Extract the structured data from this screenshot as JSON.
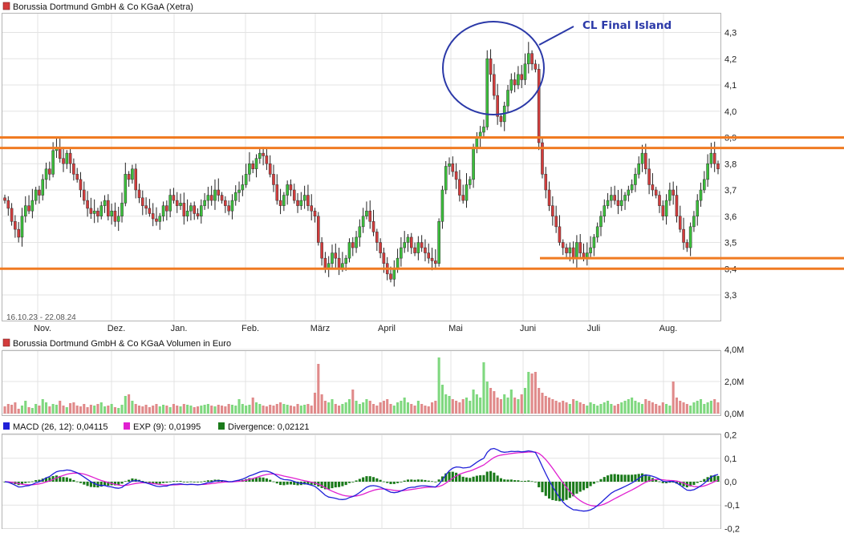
{
  "chart_data": [
    {
      "type": "candlestick",
      "title": "Borussia Dortmund GmbH & Co KGaA (Xetra)",
      "date_range": "16.10.23 - 22.08.24",
      "x_tick_labels": [
        "Nov.",
        "Dez.",
        "Jan.",
        "Feb.",
        "März",
        "April",
        "Mai",
        "Juni",
        "Juli",
        "Aug."
      ],
      "y_tick_labels": [
        "4,3",
        "4,2",
        "4,1",
        "4,0",
        "3,9",
        "3,8",
        "3,7",
        "3,6",
        "3,5",
        "3,4",
        "3,3"
      ],
      "y_range": [
        3.22,
        4.34
      ],
      "closes": [
        3.66,
        3.63,
        3.58,
        3.55,
        3.52,
        3.6,
        3.64,
        3.62,
        3.66,
        3.7,
        3.68,
        3.74,
        3.78,
        3.76,
        3.85,
        3.86,
        3.82,
        3.8,
        3.84,
        3.8,
        3.76,
        3.74,
        3.7,
        3.66,
        3.63,
        3.61,
        3.62,
        3.6,
        3.64,
        3.66,
        3.6,
        3.62,
        3.58,
        3.6,
        3.65,
        3.76,
        3.74,
        3.78,
        3.7,
        3.67,
        3.64,
        3.63,
        3.61,
        3.59,
        3.58,
        3.6,
        3.64,
        3.62,
        3.68,
        3.66,
        3.64,
        3.65,
        3.6,
        3.62,
        3.64,
        3.61,
        3.6,
        3.64,
        3.66,
        3.68,
        3.66,
        3.7,
        3.68,
        3.66,
        3.64,
        3.62,
        3.66,
        3.69,
        3.7,
        3.72,
        3.76,
        3.8,
        3.78,
        3.82,
        3.84,
        3.83,
        3.8,
        3.76,
        3.72,
        3.66,
        3.64,
        3.68,
        3.72,
        3.7,
        3.66,
        3.64,
        3.66,
        3.68,
        3.64,
        3.62,
        3.6,
        3.5,
        3.44,
        3.4,
        3.42,
        3.46,
        3.44,
        3.4,
        3.42,
        3.44,
        3.5,
        3.48,
        3.52,
        3.56,
        3.6,
        3.62,
        3.58,
        3.54,
        3.5,
        3.46,
        3.42,
        3.38,
        3.36,
        3.4,
        3.44,
        3.48,
        3.5,
        3.52,
        3.48,
        3.46,
        3.5,
        3.48,
        3.46,
        3.44,
        3.43,
        3.42,
        3.58,
        3.7,
        3.79,
        3.8,
        3.77,
        3.74,
        3.68,
        3.66,
        3.72,
        3.74,
        3.86,
        3.9,
        3.92,
        3.94,
        4.2,
        4.14,
        4.06,
        3.98,
        3.96,
        4.02,
        4.08,
        4.12,
        4.1,
        4.14,
        4.12,
        4.18,
        4.22,
        4.18,
        4.16,
        3.88,
        3.76,
        3.7,
        3.64,
        3.6,
        3.56,
        3.5,
        3.48,
        3.46,
        3.48,
        3.44,
        3.5,
        3.46,
        3.44,
        3.46,
        3.48,
        3.52,
        3.56,
        3.6,
        3.64,
        3.66,
        3.68,
        3.66,
        3.64,
        3.66,
        3.68,
        3.7,
        3.72,
        3.76,
        3.8,
        3.84,
        3.78,
        3.72,
        3.7,
        3.68,
        3.64,
        3.6,
        3.66,
        3.7,
        3.68,
        3.6,
        3.55,
        3.5,
        3.48,
        3.56,
        3.6,
        3.66,
        3.7,
        3.74,
        3.8,
        3.84,
        3.8,
        3.78
      ],
      "reference_lines": [
        {
          "y": 3.9,
          "color": "#f07b22"
        },
        {
          "y": 3.86,
          "color": "#f07b22"
        },
        {
          "y": 3.4,
          "color": "#f07b22"
        }
      ],
      "support_line": {
        "y": 3.44,
        "color": "#f07b22"
      },
      "annotation": {
        "text": "CL Final Island",
        "color": "#2b39a8"
      },
      "up_color": "#3bbf3b",
      "down_color": "#d33c3c"
    },
    {
      "type": "bar",
      "title": "Borussia Dortmund GmbH & Co KGaA Volumen in Euro",
      "y_tick_labels": [
        "4,0M",
        "2,0M",
        "0,0M"
      ],
      "y_range": [
        0,
        4.0
      ],
      "unit": "Mio. Euro",
      "values": [
        0.45,
        0.6,
        0.55,
        0.7,
        0.3,
        0.5,
        0.8,
        0.4,
        0.35,
        0.6,
        0.5,
        0.9,
        0.7,
        0.45,
        0.6,
        0.55,
        0.8,
        0.5,
        0.4,
        0.65,
        0.7,
        0.5,
        0.45,
        0.6,
        0.4,
        0.55,
        0.5,
        0.6,
        0.7,
        0.45,
        0.5,
        0.6,
        0.4,
        0.35,
        0.55,
        1.1,
        1.2,
        0.8,
        0.6,
        0.5,
        0.45,
        0.55,
        0.4,
        0.5,
        0.6,
        0.45,
        0.55,
        0.5,
        0.4,
        0.6,
        0.5,
        0.45,
        0.6,
        0.55,
        0.5,
        0.4,
        0.45,
        0.5,
        0.55,
        0.6,
        0.5,
        0.45,
        0.55,
        0.5,
        0.45,
        0.6,
        0.55,
        0.5,
        0.9,
        0.6,
        0.5,
        0.55,
        1.0,
        0.7,
        0.6,
        0.5,
        0.45,
        0.55,
        0.5,
        0.6,
        0.7,
        0.6,
        0.55,
        0.5,
        0.45,
        0.6,
        0.5,
        0.55,
        0.6,
        0.5,
        1.3,
        3.1,
        1.2,
        0.8,
        0.7,
        0.9,
        0.6,
        0.5,
        0.6,
        0.7,
        0.9,
        1.5,
        0.8,
        0.6,
        0.7,
        0.9,
        0.8,
        0.6,
        0.5,
        0.7,
        0.8,
        0.9,
        0.6,
        0.5,
        0.7,
        0.8,
        1.0,
        0.7,
        0.6,
        0.5,
        0.8,
        0.6,
        0.5,
        0.45,
        0.7,
        0.8,
        3.5,
        1.8,
        1.2,
        1.1,
        0.9,
        0.8,
        0.7,
        0.9,
        1.0,
        0.8,
        1.5,
        1.2,
        1.0,
        3.2,
        2.0,
        1.6,
        1.4,
        1.0,
        0.9,
        1.2,
        1.0,
        1.5,
        1.0,
        0.9,
        1.2,
        1.6,
        2.6,
        2.5,
        2.6,
        1.6,
        1.3,
        1.1,
        1.0,
        0.9,
        0.8,
        0.7,
        0.8,
        0.7,
        0.6,
        0.9,
        0.8,
        0.7,
        0.6,
        0.5,
        0.7,
        0.6,
        0.5,
        0.6,
        0.7,
        0.8,
        0.6,
        0.5,
        0.6,
        0.7,
        0.8,
        0.9,
        1.0,
        0.8,
        0.7,
        0.6,
        0.9,
        0.8,
        0.7,
        0.6,
        0.5,
        0.7,
        0.6,
        0.5,
        2.0,
        1.0,
        0.8,
        0.7,
        0.6,
        0.5,
        0.7,
        0.8,
        0.9,
        0.6,
        0.7,
        0.8,
        0.9,
        0.7
      ],
      "up_color": "#7fd87f",
      "down_color": "#e08a8a",
      "neutral_color": "#b4b4b4"
    },
    {
      "type": "line",
      "title": "MACD",
      "y_tick_labels": [
        "0,2",
        "0,1",
        "0,0",
        "-0,1",
        "-0,2"
      ],
      "y_range": [
        -0.2,
        0.2
      ],
      "series": [
        {
          "name": "MACD (26, 12)",
          "value_label": "0,04115",
          "color": "#2020d8"
        },
        {
          "name": "EXP (9)",
          "value_label": "0,01995",
          "color": "#e020d0"
        },
        {
          "name": "Divergence",
          "value_label": "0,02121",
          "color": "#1a7a1a"
        }
      ]
    }
  ]
}
